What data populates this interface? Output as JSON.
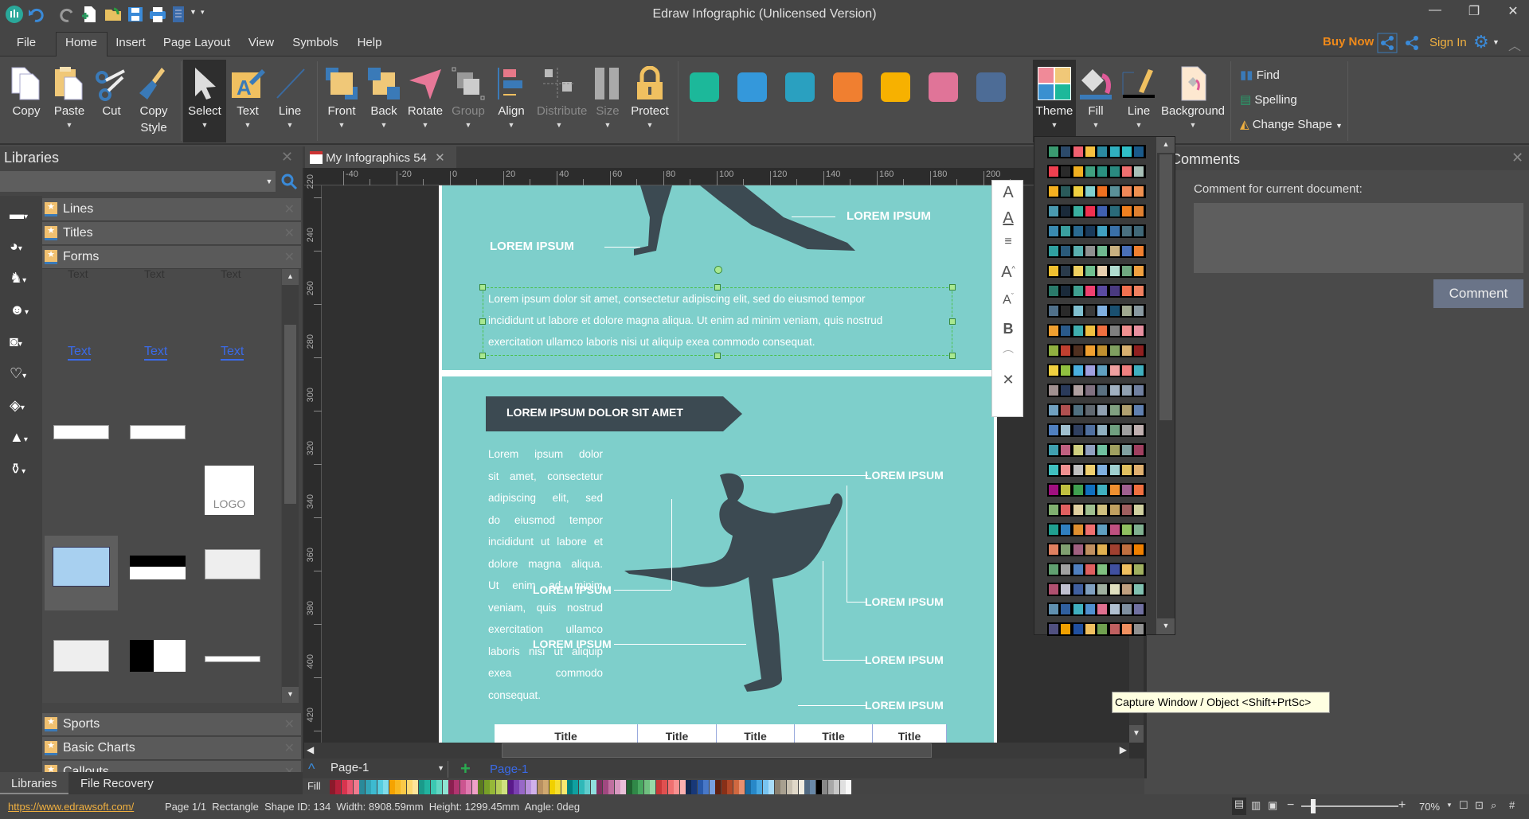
{
  "app": {
    "title": "Edraw Infographic (Unlicensed Version)"
  },
  "menu": {
    "items": [
      "File",
      "Home",
      "Insert",
      "Page Layout",
      "View",
      "Symbols",
      "Help"
    ],
    "buy_now": "Buy Now",
    "sign_in": "Sign In"
  },
  "ribbon": {
    "clipboard": [
      "Copy",
      "Paste",
      "Cut",
      "Copy"
    ],
    "copy_style_line2": "Style",
    "tools": [
      "Select",
      "Text",
      "Line"
    ],
    "arrange": [
      "Front",
      "Back",
      "Rotate",
      "Group",
      "Align",
      "Distribute",
      "Size",
      "Protect"
    ],
    "theme_colors": [
      "#1cb89a",
      "#3498db",
      "#2aa0c0",
      "#f07f30",
      "#f7b100",
      "#e07498",
      "#4d6c96"
    ],
    "style": [
      "Theme",
      "Fill",
      "Line",
      "Background"
    ],
    "editing": [
      "Find",
      "Spelling",
      "Change Shape"
    ]
  },
  "libraries": {
    "title": "Libraries",
    "search_placeholder": "",
    "categories_top": [
      "Lines",
      "Titles",
      "Forms"
    ],
    "categories_bottom": [
      "Sports",
      "Basic Charts",
      "Callouts"
    ],
    "thumb_labels": [
      "Text",
      "Text",
      "Text",
      "Text",
      "Text",
      "Text"
    ],
    "logo_text": "LOGO",
    "tabs": [
      "Libraries",
      "File Recovery"
    ]
  },
  "document": {
    "tab": "My Infographics 54",
    "ruler_h": [
      "-40",
      "-20",
      "0",
      "20",
      "40",
      "60",
      "80",
      "100",
      "120",
      "140",
      "160",
      "180",
      "200"
    ],
    "ruler_v": [
      "220",
      "240",
      "260",
      "280",
      "300",
      "320",
      "340",
      "360",
      "380",
      "400",
      "420"
    ],
    "section1": {
      "label_right": "LOREM IPSUM",
      "label_left": "LOREM IPSUM",
      "body": [
        "Lorem ipsum dolor sit amet, consectetur adipiscing elit, sed do eiusmod tempor",
        "incididunt ut labore et dolore magna aliqua. Ut enim ad minim veniam, quis nostrud",
        "exercitation ullamco laboris nisi ut aliquip exea commodo consequat."
      ]
    },
    "section2": {
      "banner": "LOREM IPSUM DOLOR SIT AMET",
      "column": [
        "Lorem ipsum dolor",
        "sit amet, consectetur",
        "adipiscing elit, sed",
        "do eiusmod tempor",
        "incididunt ut labore et",
        "dolore magna aliqua.",
        "Ut enim ad minim",
        "veniam, quis nostrud",
        "exercitation ullamco",
        "laboris nisi ut aliquip",
        "exea commodo",
        "consequat."
      ],
      "labels": [
        "LOREM IPSUM",
        "LOREM IPSUM",
        "LOREM IPSUM",
        "LOREM IPSUM",
        "LOREM IPSUM",
        "LOREM IPSUM"
      ],
      "table_headers": [
        "Title",
        "Title",
        "Title",
        "Title",
        "Title"
      ]
    }
  },
  "pages": {
    "selector": "Page-1",
    "active_tab": "Page-1",
    "fill_label": "Fill"
  },
  "fill_palette": [
    "#8b1a2b",
    "#b5203a",
    "#d8344e",
    "#e85670",
    "#f07a8e",
    "#2a8a9a",
    "#33a5b8",
    "#3dbad0",
    "#55cde0",
    "#80dcea",
    "#f5a300",
    "#f8b820",
    "#fbc948",
    "#fdd870",
    "#fee49a",
    "#1a9a8a",
    "#22b39f",
    "#3cc8b2",
    "#62d6c2",
    "#8ee3d3",
    "#8a2050",
    "#b03570",
    "#cc5590",
    "#e07ab0",
    "#f0a0c8",
    "#5a7a20",
    "#78a028",
    "#96b838",
    "#b4cc58",
    "#cfe080",
    "#5a1a8a",
    "#7a40b0",
    "#9868c8",
    "#b890dc",
    "#d0b0ea",
    "#b89060",
    "#d0a870",
    "#f0d000",
    "#f5de30",
    "#f8e870",
    "#008080",
    "#10a0a0",
    "#30b8b8",
    "#60cccc",
    "#90dede",
    "#803060",
    "#a04880",
    "#c070a0",
    "#d898c0",
    "#e8c0d8",
    "#206030",
    "#308848",
    "#48a860",
    "#70c080",
    "#98d8a8",
    "#c83838",
    "#e05050",
    "#f07070",
    "#f89090",
    "#fab0b0",
    "#102850",
    "#183878",
    "#2858a8",
    "#4878c8",
    "#78a0e0",
    "#602010",
    "#883018",
    "#b04828",
    "#d06840",
    "#e89070",
    "#1a6aa0",
    "#2888c8",
    "#48a8e0",
    "#78c4f0",
    "#a8dcf8",
    "#8a8070",
    "#a8a090",
    "#c8c0b0",
    "#e0d8c8",
    "#f0ece0",
    "#506880",
    "#6888a8",
    "#000000",
    "#888888",
    "#a8a8a8",
    "#c8c8c8",
    "#e0e0e0",
    "#f8f8f8"
  ],
  "theme_palettes": [
    [
      "#3a9a70",
      "#2c4a6a",
      "#f06070",
      "#f5c040",
      "#2a8aa0",
      "#30b0c0",
      "#30c0c8",
      "#1a5a8a"
    ],
    [
      "#f04050",
      "#2a2a2a",
      "#f0b020",
      "#40a080",
      "#2a9080",
      "#2a8a80",
      "#f07070",
      "#a8c0b8"
    ],
    [
      "#f5b020",
      "#2a5a5a",
      "#f0d040",
      "#80d0d0",
      "#f07020",
      "#5a9098",
      "#f08858",
      "#f09050"
    ],
    [
      "#4a9ab0",
      "#1a2a3a",
      "#3ab0a0",
      "#f03050",
      "#4060b0",
      "#2a6a7a",
      "#f08020",
      "#e08030"
    ],
    [
      "#3a8ab0",
      "#3aa0a0",
      "#2a6a90",
      "#1a3a5a",
      "#40a0c0",
      "#3a70a8",
      "#4a7080",
      "#406878"
    ],
    [
      "#30a0a0",
      "#2a5a7a",
      "#5ab0b0",
      "#909090",
      "#70b890",
      "#c8b080",
      "#4a70b8",
      "#f08030"
    ],
    [
      "#f0c030",
      "#2a3a4a",
      "#f0d060",
      "#70c090",
      "#e8d0b0",
      "#b0dcd0",
      "#70a880",
      "#f0a040"
    ],
    [
      "#2a7a6a",
      "#1a2a3a",
      "#40a090",
      "#f04070",
      "#5a4aa0",
      "#4a3a80",
      "#f07050",
      "#f08060"
    ],
    [
      "#50708a",
      "#2a2a2a",
      "#80c0d0",
      "#3a3a3a",
      "#80b0e0",
      "#1a5070",
      "#a0a890",
      "#8898a0"
    ],
    [
      "#f0a030",
      "#2a5a8a",
      "#40b0b0",
      "#f0c040",
      "#f07040",
      "#808080",
      "#f09090",
      "#e890a0"
    ],
    [
      "#90b040",
      "#c04030",
      "#503020",
      "#f0a030",
      "#c09030",
      "#80a060",
      "#d8b070",
      "#902020"
    ],
    [
      "#f0d040",
      "#90c040",
      "#4ab0e0",
      "#a0a0e0",
      "#60a0c0",
      "#f0a0a0",
      "#f08080",
      "#40b0c0"
    ],
    [
      "#a09090",
      "#2a3a5a",
      "#b0a0a0",
      "#807080",
      "#5a7080",
      "#a0b0c0",
      "#90a0b0",
      "#7080a0"
    ],
    [
      "#70a0c0",
      "#b05050",
      "#507080",
      "#606870",
      "#90a0b0",
      "#80a080",
      "#b0a070",
      "#6080b0"
    ],
    [
      "#5080c0",
      "#a0c0d0",
      "#304060",
      "#5070a0",
      "#90b0c0",
      "#70a080",
      "#a0a0a0",
      "#c0b0b0"
    ],
    [
      "#40a0b0",
      "#c06080",
      "#d0d080",
      "#90a0c0",
      "#70c0a0",
      "#a0a060",
      "#80a0a0",
      "#a04060"
    ],
    [
      "#40c0c0",
      "#f09090",
      "#c0c0c0",
      "#f0d070",
      "#80b0e0",
      "#a0d0d0",
      "#e0c060",
      "#e0b070"
    ],
    [
      "#a01080",
      "#c0c040",
      "#40a050",
      "#1070c0",
      "#40b0c0",
      "#f09030",
      "#a06090",
      "#f07040"
    ],
    [
      "#80b070",
      "#e06060",
      "#e0d0a0",
      "#a0c090",
      "#d0c080",
      "#c0a060",
      "#a06060",
      "#d0d0a0"
    ],
    [
      "#20a090",
      "#3080c0",
      "#e09030",
      "#f07070",
      "#60a0c0",
      "#c05080",
      "#90c060",
      "#80b090"
    ],
    [
      "#e08060",
      "#80a070",
      "#a06080",
      "#c09060",
      "#e0b050",
      "#a04030",
      "#c07040",
      "#f08000"
    ],
    [
      "#60a070",
      "#a0a0a0",
      "#5080c0",
      "#e06060",
      "#80c080",
      "#4050a0",
      "#f0c060",
      "#a0b060"
    ],
    [
      "#b05070",
      "#c0c0d0",
      "#4060a0",
      "#80a0c0",
      "#a0b0a0",
      "#e0e0c0",
      "#c0a080",
      "#80c0b0"
    ],
    [
      "#6090b0",
      "#3060a0",
      "#40b0c0",
      "#5090d0",
      "#e07090",
      "#b0c0d0",
      "#8090a0",
      "#7070a0"
    ],
    [
      "#505080",
      "#f0a000",
      "#2050a0",
      "#f0c060",
      "#70a050",
      "#c06060",
      "#f09060",
      "#909090"
    ]
  ],
  "comments": {
    "title": "Comments",
    "label": "Comment for current document:",
    "button": "Comment"
  },
  "tooltip": "Capture Window / Object <Shift+PrtSc>",
  "status": {
    "url": "https://www.edrawsoft.com/",
    "page": "Page 1/1",
    "shape": "Rectangle",
    "shape_id": "Shape ID: 134",
    "width": "Width: 8908.59mm",
    "height": "Height: 1299.45mm",
    "angle": "Angle: 0deg",
    "zoom": "70%",
    "zoom_level": 0.7
  }
}
